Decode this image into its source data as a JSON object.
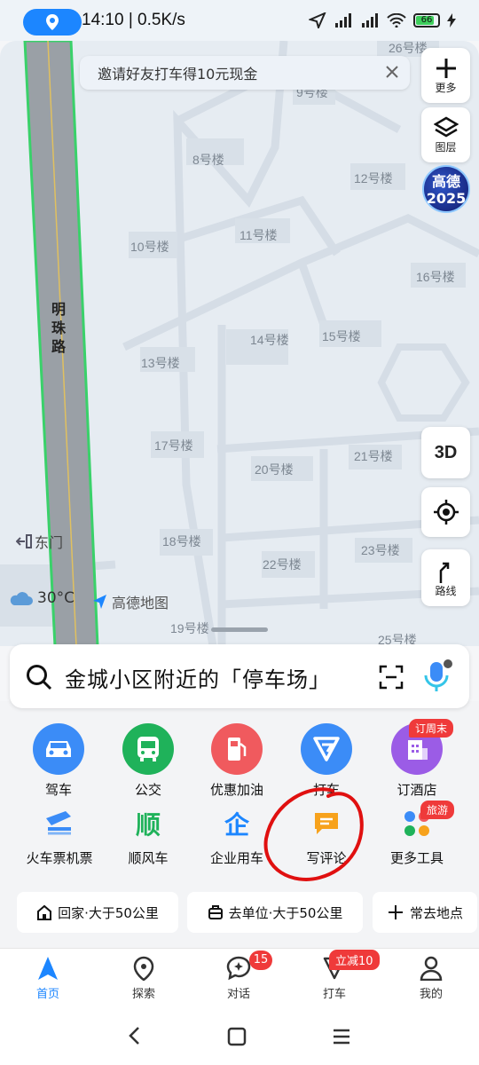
{
  "status": {
    "time": "14:10 | 0.5K/s",
    "battery": "66"
  },
  "map": {
    "buildings": [
      "26号楼",
      "9号楼",
      "8号楼",
      "12号楼",
      "10号楼",
      "11号楼",
      "16号楼",
      "14号楼",
      "15号楼",
      "13号楼",
      "17号楼",
      "20号楼",
      "21号楼",
      "18号楼",
      "22号楼",
      "23号楼",
      "19号楼",
      "25号楼"
    ],
    "road": "明珠路",
    "gate": "东门",
    "temperature": "30°C",
    "brand": "高德地图",
    "badge_line1": "高德",
    "badge_line2": "2025"
  },
  "invite": {
    "text": "邀请好友打车得10元现金"
  },
  "map_controls": {
    "more": "更多",
    "layers": "图层",
    "three_d": "3D",
    "route": "路线"
  },
  "search": {
    "text": "金城小区附近的「停车场」"
  },
  "quick": [
    {
      "label": "驾车"
    },
    {
      "label": "公交"
    },
    {
      "label": "优惠加油"
    },
    {
      "label": "打车"
    },
    {
      "label": "订酒店",
      "tag": "订周末"
    }
  ],
  "services": [
    {
      "label": "火车票机票"
    },
    {
      "label": "顺风车",
      "icon_text": "顺"
    },
    {
      "label": "企业用车",
      "icon_text": "企"
    },
    {
      "label": "写评论"
    },
    {
      "label": "更多工具",
      "tag": "旅游"
    }
  ],
  "destinations": {
    "home": "回家·大于50公里",
    "work": "去单位·大于50公里",
    "frequent": "常去地点"
  },
  "nav": [
    {
      "label": "首页"
    },
    {
      "label": "探索"
    },
    {
      "label": "对话",
      "badge": "15"
    },
    {
      "label": "打车",
      "badge": "立减10"
    },
    {
      "label": "我的"
    }
  ],
  "colors": {
    "accent": "#1c86ff",
    "tag": "#ef3a3a",
    "annotation": "#e01010"
  }
}
